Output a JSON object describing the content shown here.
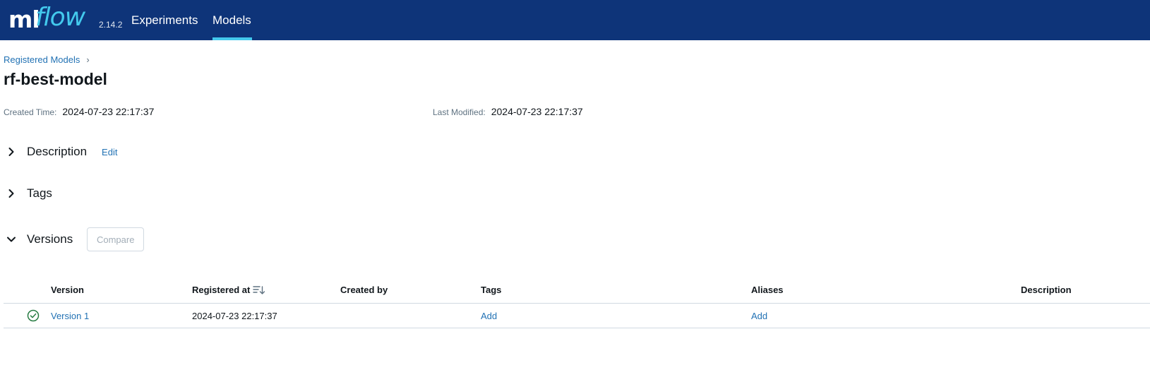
{
  "header": {
    "logo_ml": "ml",
    "logo_flow": "flow",
    "version": "2.14.2",
    "nav": [
      {
        "label": "Experiments",
        "active": false
      },
      {
        "label": "Models",
        "active": true
      }
    ],
    "colors": {
      "background": "#0e3479",
      "accent": "#43c9ed"
    }
  },
  "breadcrumb": {
    "link": "Registered Models",
    "separator": "›"
  },
  "page_title": "rf-best-model",
  "meta": {
    "created_label": "Created Time:",
    "created_value": "2024-07-23 22:17:37",
    "modified_label": "Last Modified:",
    "modified_value": "2024-07-23 22:17:37"
  },
  "sections": {
    "description": {
      "title": "Description",
      "edit_label": "Edit",
      "expanded": false,
      "icon": "chevron-right-icon"
    },
    "tags": {
      "title": "Tags",
      "expanded": false,
      "icon": "chevron-right-icon"
    },
    "versions": {
      "title": "Versions",
      "compare_label": "Compare",
      "expanded": true,
      "icon": "chevron-down-icon"
    }
  },
  "table": {
    "columns": [
      "Version",
      "Registered at",
      "Created by",
      "Tags",
      "Aliases",
      "Description"
    ],
    "sort_icon": "sort-descending-icon",
    "rows": [
      {
        "status_icon": "check-circle-icon",
        "version": "Version 1",
        "registered_at": "2024-07-23 22:17:37",
        "created_by": "",
        "tags": "Add",
        "aliases": "Add",
        "description": ""
      }
    ]
  },
  "colors": {
    "link": "#2272b4",
    "success": "#277c43",
    "border": "#d1d9e1"
  }
}
